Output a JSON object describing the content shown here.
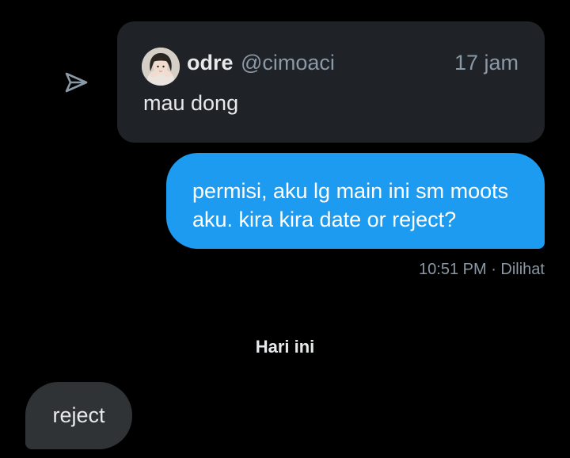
{
  "icons": {
    "share": "share-send-icon"
  },
  "quoted_post": {
    "author_name": "odre",
    "author_handle": "@cimoaci",
    "time": "17 jam",
    "text": "mau dong"
  },
  "sent_message": {
    "text": "permisi, aku lg main ini sm moots aku. kira kira date or reject?",
    "meta": "10:51 PM · Dilihat"
  },
  "date_divider": "Hari ini",
  "received_message": {
    "text": "reject"
  },
  "colors": {
    "background": "#000000",
    "card": "#1f2327",
    "sent_bubble": "#1d9bf0",
    "received_bubble": "#2f3336",
    "muted_text": "#8b98a5"
  }
}
